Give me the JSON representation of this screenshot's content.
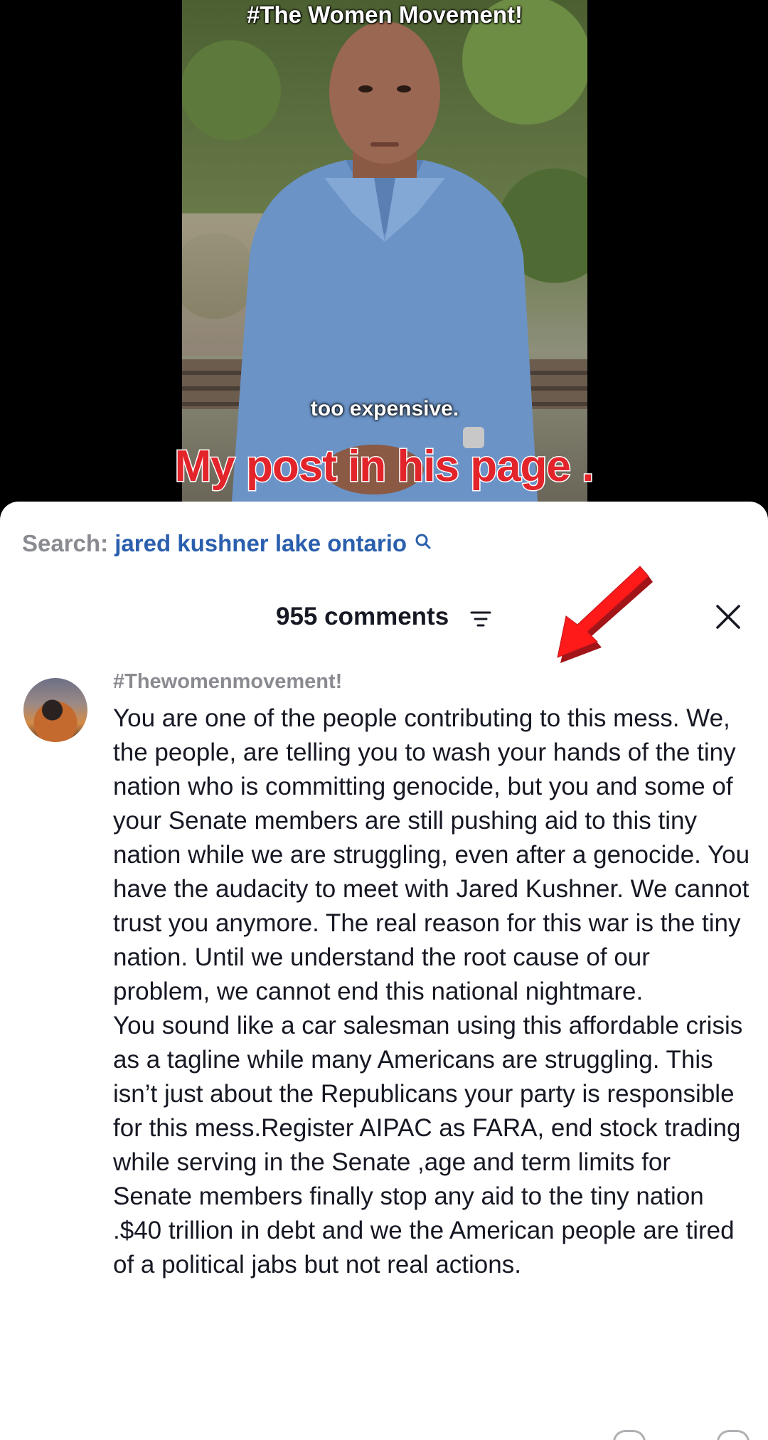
{
  "video": {
    "hashtag_overlay": "#The Women Movement!",
    "caption": "too expensive.",
    "title_overlay": "My post in his page ."
  },
  "search": {
    "prefix": "Search:",
    "query": "jared kushner lake ontario"
  },
  "comments_header": {
    "count_label": "955 comments"
  },
  "comment": {
    "author": "#Thewomenmovement!",
    "paragraphs": [
      "You are one of the people contributing to this mess. We, the people, are telling you to wash your hands of the tiny nation who is committing genocide, but you and some of your Senate members are still pushing aid to this tiny nation while we are struggling, even after a genocide. You have the audacity to meet with Jared Kushner. We cannot trust you anymore. The real reason for this war is the tiny nation. Until we understand the root cause of our problem, we cannot end this national nightmare.",
      "You sound like a car salesman using this affordable crisis as a tagline while many Americans are struggling. This isn’t just about the Republicans your party is responsible for this mess.Register AIPAC as FARA, end stock trading while serving in the Senate ,age and term limits for Senate members finally stop any aid to the tiny nation .$40 trillion in debt and we the American people are tired of a political jabs but not real actions."
    ]
  },
  "colors": {
    "accent_red": "#e3242b",
    "search_query": "#2b5fad",
    "muted_text": "#8a8b91",
    "body_text": "#161823"
  },
  "icons": {
    "search": "search-icon",
    "filter": "filter-icon",
    "close": "close-icon",
    "annotation": "red-arrow-icon"
  }
}
